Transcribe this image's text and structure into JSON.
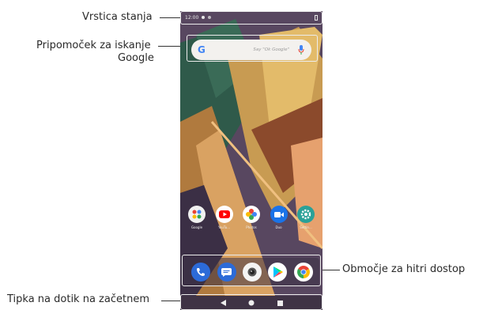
{
  "callouts": {
    "status_bar": "Vrstica stanja",
    "google_search_line1": "Pripomoček za iskanje",
    "google_search_line2": "Google",
    "quick_access": "Območje za hitri dostop",
    "home_touch_key": "Tipka na dotik na začetnem"
  },
  "phone": {
    "status_bar": {
      "time": "12:00"
    },
    "search": {
      "logo": "G",
      "hint": "Say \"Ok Google\""
    },
    "home_apps": [
      {
        "label": "Google",
        "icon": "google-folder-icon",
        "color": "#f1f1f1"
      },
      {
        "label": "YouTu...",
        "icon": "youtube-icon",
        "color": "#ffffff"
      },
      {
        "label": "Photos",
        "icon": "photos-icon",
        "color": "#ffffff"
      },
      {
        "label": "Duo",
        "icon": "duo-icon",
        "color": "#1a73e8"
      },
      {
        "label": "Settin...",
        "icon": "settings-icon",
        "color": "#2aa198"
      }
    ],
    "dock_apps": [
      {
        "icon": "phone-icon",
        "color": "#2c6bd8"
      },
      {
        "icon": "messages-icon",
        "color": "#2c6bd8"
      },
      {
        "icon": "camera-icon",
        "color": "#f4f4f4"
      },
      {
        "icon": "play-store-icon",
        "color": "#ffffff"
      },
      {
        "icon": "chrome-icon",
        "color": "#ffffff"
      }
    ]
  }
}
